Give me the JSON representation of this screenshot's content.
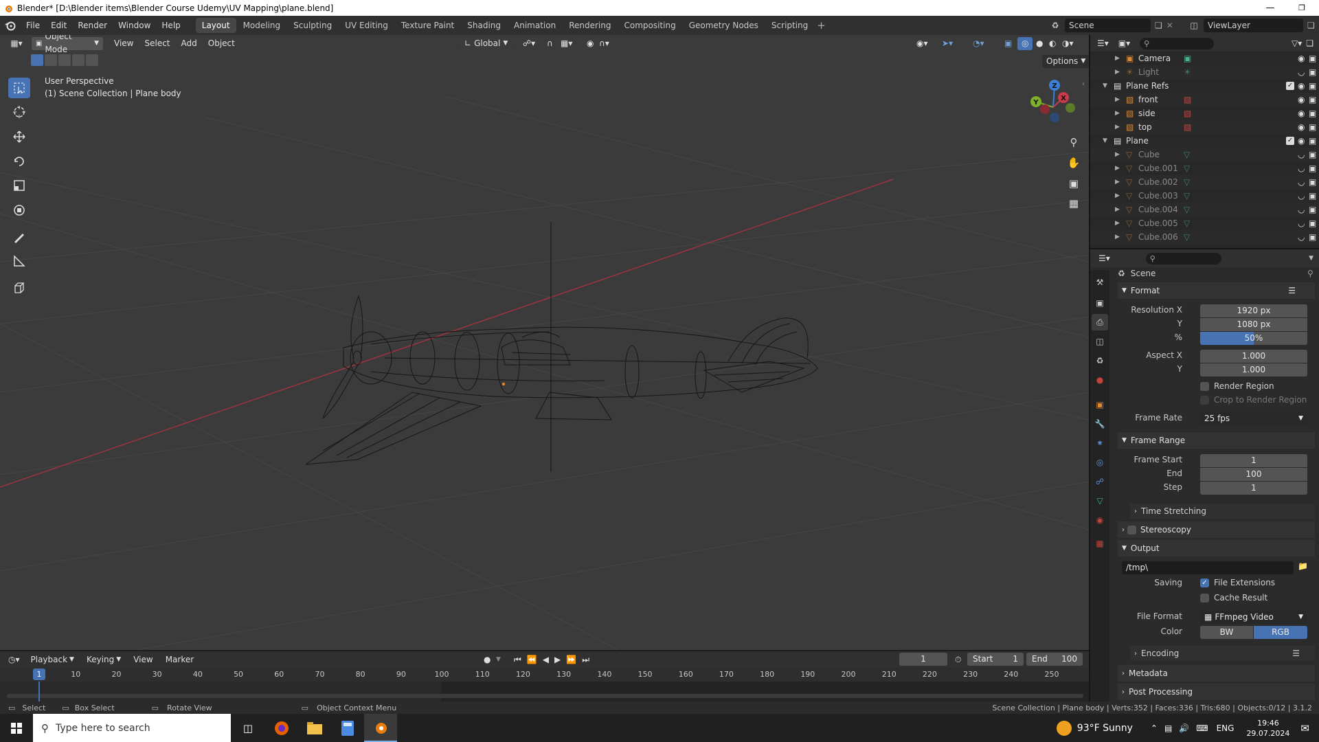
{
  "window": {
    "title": "Blender* [D:\\Blender items\\Blender Course Udemy\\UV Mapping\\plane.blend]"
  },
  "menu": [
    "File",
    "Edit",
    "Render",
    "Window",
    "Help"
  ],
  "workspaces": [
    "Layout",
    "Modeling",
    "Sculpting",
    "UV Editing",
    "Texture Paint",
    "Shading",
    "Animation",
    "Rendering",
    "Compositing",
    "Geometry Nodes",
    "Scripting"
  ],
  "active_workspace": "Layout",
  "scene_field": "Scene",
  "viewlayer_field": "ViewLayer",
  "viewport": {
    "mode": "Object Mode",
    "menus": [
      "View",
      "Select",
      "Add",
      "Object"
    ],
    "orientation": "Global",
    "options": "Options",
    "info_line1": "User Perspective",
    "info_line2": "(1) Scene Collection | Plane body",
    "gizmo": {
      "x": "X",
      "y": "Y",
      "z": "Z"
    }
  },
  "outliner": {
    "items": [
      {
        "label": "Camera",
        "type": "camera",
        "indent": 1,
        "dim": false
      },
      {
        "label": "Light",
        "type": "light",
        "indent": 1,
        "dim": true
      },
      {
        "label": "Plane Refs",
        "type": "collection",
        "indent": 0,
        "dim": false
      },
      {
        "label": "front",
        "type": "image",
        "indent": 1,
        "dim": false
      },
      {
        "label": "side",
        "type": "image",
        "indent": 1,
        "dim": false
      },
      {
        "label": "top",
        "type": "image",
        "indent": 1,
        "dim": false
      },
      {
        "label": "Plane",
        "type": "collection",
        "indent": 0,
        "dim": false
      },
      {
        "label": "Cube",
        "type": "mesh",
        "indent": 1,
        "dim": true
      },
      {
        "label": "Cube.001",
        "type": "mesh",
        "indent": 1,
        "dim": true
      },
      {
        "label": "Cube.002",
        "type": "mesh",
        "indent": 1,
        "dim": true
      },
      {
        "label": "Cube.003",
        "type": "mesh",
        "indent": 1,
        "dim": true
      },
      {
        "label": "Cube.004",
        "type": "mesh",
        "indent": 1,
        "dim": true
      },
      {
        "label": "Cube.005",
        "type": "mesh",
        "indent": 1,
        "dim": true
      },
      {
        "label": "Cube.006",
        "type": "mesh",
        "indent": 1,
        "dim": true
      }
    ]
  },
  "properties": {
    "context": "Scene",
    "format": {
      "title": "Format",
      "res_x_label": "Resolution X",
      "res_x": "1920 px",
      "res_y_label": "Y",
      "res_y": "1080 px",
      "pct_label": "%",
      "pct": "50%",
      "pct_fraction": 0.5,
      "aspect_x_label": "Aspect X",
      "aspect_x": "1.000",
      "aspect_y_label": "Y",
      "aspect_y": "1.000",
      "render_region": "Render Region",
      "crop": "Crop to Render Region",
      "frame_rate_label": "Frame Rate",
      "frame_rate": "25 fps"
    },
    "frame_range": {
      "title": "Frame Range",
      "start_label": "Frame Start",
      "start": "1",
      "end_label": "End",
      "end": "100",
      "step_label": "Step",
      "step": "1"
    },
    "time_stretching": "Time Stretching",
    "stereoscopy": "Stereoscopy",
    "output": {
      "title": "Output",
      "path": "/tmp\\",
      "saving_label": "Saving",
      "file_extensions": "File Extensions",
      "cache_result": "Cache Result",
      "file_format_label": "File Format",
      "file_format": "FFmpeg Video",
      "color_label": "Color",
      "color_bw": "BW",
      "color_rgb": "RGB"
    },
    "encoding": "Encoding",
    "metadata": "Metadata",
    "post_processing": "Post Processing"
  },
  "timeline": {
    "menus": [
      "Playback",
      "Keying",
      "View",
      "Marker"
    ],
    "current_frame": "1",
    "start_label": "Start",
    "start": "1",
    "end_label": "End",
    "end": "100",
    "ticks": [
      "1",
      "10",
      "20",
      "30",
      "40",
      "50",
      "60",
      "70",
      "80",
      "90",
      "100",
      "110",
      "120",
      "130",
      "140",
      "150",
      "160",
      "170",
      "180",
      "190",
      "200",
      "210",
      "220",
      "230",
      "240",
      "250"
    ]
  },
  "status": {
    "select": "Select",
    "box_select": "Box Select",
    "rotate_view": "Rotate View",
    "context_menu": "Object Context Menu",
    "stats": "Scene Collection | Plane body | Verts:352 | Faces:336 | Tris:680 | Objects:0/12 | 3.1.2"
  },
  "taskbar": {
    "search_placeholder": "Type here to search",
    "weather": "93°F  Sunny",
    "lang": "ENG",
    "time": "19:46",
    "date": "29.07.2024"
  },
  "colors": {
    "accent": "#4772b3",
    "x_axis": "#c93a4a",
    "y_axis": "#7fb02a",
    "z_axis": "#3b7fd6"
  }
}
